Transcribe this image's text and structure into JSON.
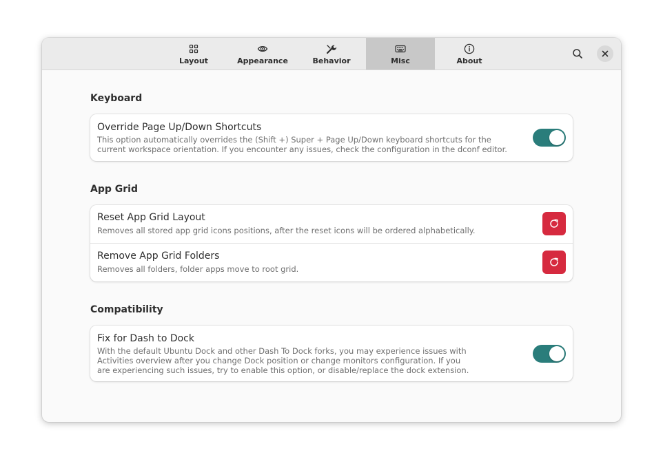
{
  "tabs": [
    {
      "label": "Layout",
      "icon": "grid-icon",
      "active": false
    },
    {
      "label": "Appearance",
      "icon": "eye-icon",
      "active": false
    },
    {
      "label": "Behavior",
      "icon": "wrench-icon",
      "active": false
    },
    {
      "label": "Misc",
      "icon": "keyboard-icon",
      "active": true
    },
    {
      "label": "About",
      "icon": "info-icon",
      "active": false
    }
  ],
  "header": {
    "search_icon": "search-icon",
    "close_icon": "close-icon"
  },
  "sections": {
    "keyboard": {
      "title": "Keyboard",
      "rows": [
        {
          "title": "Override Page Up/Down Shortcuts",
          "subtitle_lines": [
            "This option automatically overrides the (Shift +) Super + Page Up/Down keyboard shortcuts for the",
            "current workspace orientation. If you encounter any issues, check the configuration in the dconf editor."
          ],
          "control": "switch",
          "enabled": true
        }
      ]
    },
    "app_grid": {
      "title": "App Grid",
      "rows": [
        {
          "title": "Reset App Grid Layout",
          "subtitle_lines": [
            "Removes all stored app grid icons positions, after the reset icons will be ordered alphabetically."
          ],
          "control": "reset-button"
        },
        {
          "title": "Remove App Grid Folders",
          "subtitle_lines": [
            "Removes all folders, folder apps move to root grid."
          ],
          "control": "reset-button"
        }
      ]
    },
    "compatibility": {
      "title": "Compatibility",
      "rows": [
        {
          "title": "Fix for Dash to Dock",
          "subtitle_lines": [
            "With the default Ubuntu Dock and other Dash To Dock forks, you may experience issues with",
            "Activities overview after you change Dock position or change monitors configuration. If you",
            "are experiencing such issues, try to enable this option, or disable/replace the dock extension."
          ],
          "control": "switch",
          "enabled": true
        }
      ]
    }
  },
  "colors": {
    "accent_switch": "#2a7d7b",
    "destructive": "#d62a3f",
    "active_tab_bg": "#c8c8c8"
  }
}
